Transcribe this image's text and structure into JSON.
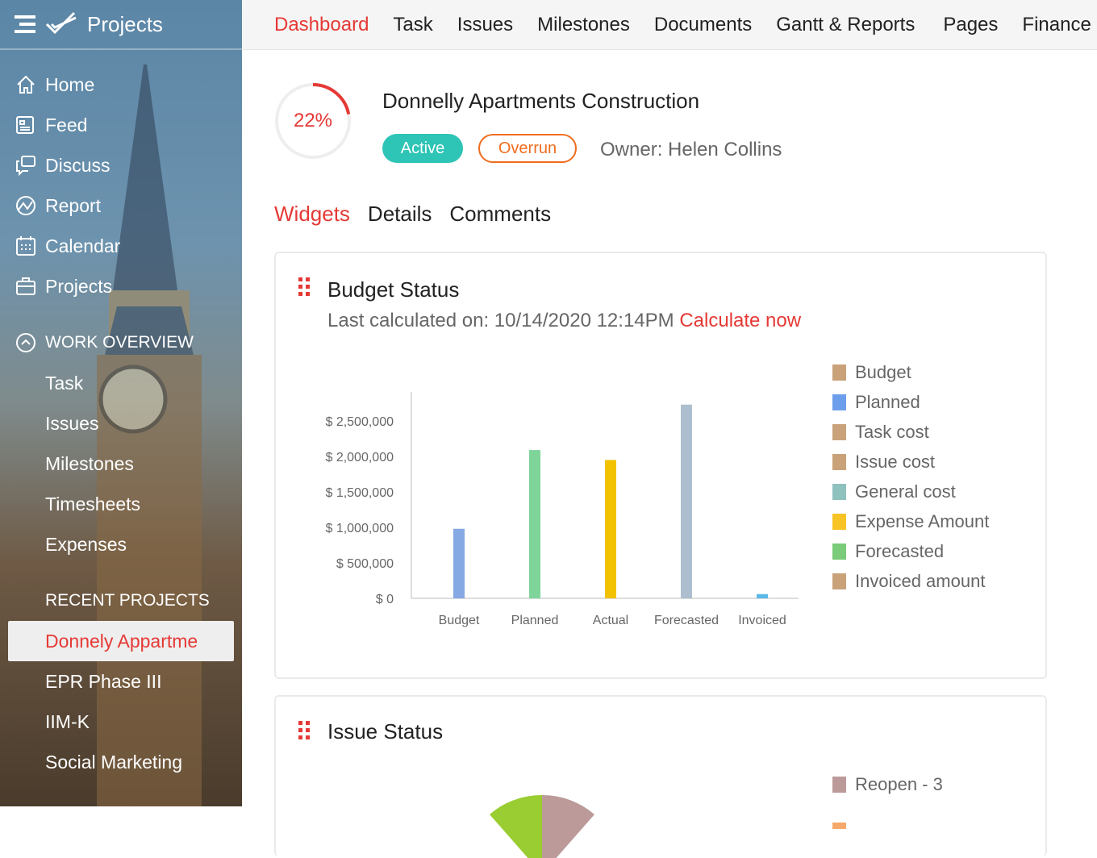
{
  "app": {
    "title": "Projects"
  },
  "sidebar": {
    "items": [
      {
        "label": "Home",
        "icon": "home-icon"
      },
      {
        "label": "Feed",
        "icon": "feed-icon"
      },
      {
        "label": "Discuss",
        "icon": "discuss-icon"
      },
      {
        "label": "Report",
        "icon": "report-icon"
      },
      {
        "label": "Calendar",
        "icon": "calendar-icon"
      },
      {
        "label": "Projects",
        "icon": "briefcase-icon"
      }
    ],
    "work_overview": {
      "label": "WORK OVERVIEW",
      "items": [
        "Task",
        "Issues",
        "Milestones",
        "Timesheets",
        "Expenses"
      ]
    },
    "recent": {
      "label": "RECENT PROJECTS",
      "items": [
        "Donnely Appartme",
        "EPR Phase III",
        "IIM-K",
        "Social Marketing"
      ]
    }
  },
  "topnav": [
    "Dashboard",
    "Task",
    "Issues",
    "Milestones",
    "Documents",
    "Gantt & Reports",
    "Pages",
    "Finance"
  ],
  "project": {
    "progress_label": "22%",
    "progress": 22,
    "title": "Donnelly Apartments Construction",
    "status": "Active",
    "flag": "Overrun",
    "owner": "Owner: Helen Collins"
  },
  "tabs": [
    "Widgets",
    "Details",
    "Comments"
  ],
  "budget": {
    "title": "Budget Status",
    "calc_label": "Last calculated on: 10/14/2020 12:14PM",
    "calc_link": "Calculate now",
    "legend": [
      {
        "label": "Budget",
        "color": "#c9a27a"
      },
      {
        "label": "Planned",
        "color": "#6d9eeb"
      },
      {
        "label": "Task cost",
        "color": "#c9a27a"
      },
      {
        "label": "Issue cost",
        "color": "#c9a27a"
      },
      {
        "label": "General cost",
        "color": "#8fc1bf"
      },
      {
        "label": "Expense Amount",
        "color": "#f7c325"
      },
      {
        "label": "Forecasted",
        "color": "#7acb7a"
      },
      {
        "label": "Invoiced amount",
        "color": "#c9a27a"
      }
    ]
  },
  "chart_data": {
    "type": "bar",
    "categories": [
      "Budget",
      "Planned",
      "Actual",
      "Forecasted",
      "Invoiced"
    ],
    "values": [
      980000,
      2090000,
      1950000,
      2730000,
      60000
    ],
    "colors": [
      "#86a8e3",
      "#7fd49a",
      "#f2c200",
      "#adbfcf",
      "#5bb8e8"
    ],
    "yticks": [
      "$ 0",
      "$ 500,000",
      "$ 1,000,000",
      "$ 1,500,000",
      "$ 2,000,000",
      "$ 2,500,000"
    ],
    "ylim": [
      0,
      2500000
    ],
    "title": "Budget Status"
  },
  "issue": {
    "title": "Issue Status",
    "legend": [
      {
        "label": "Reopen - 3",
        "color": "#bc9a9a"
      }
    ]
  }
}
